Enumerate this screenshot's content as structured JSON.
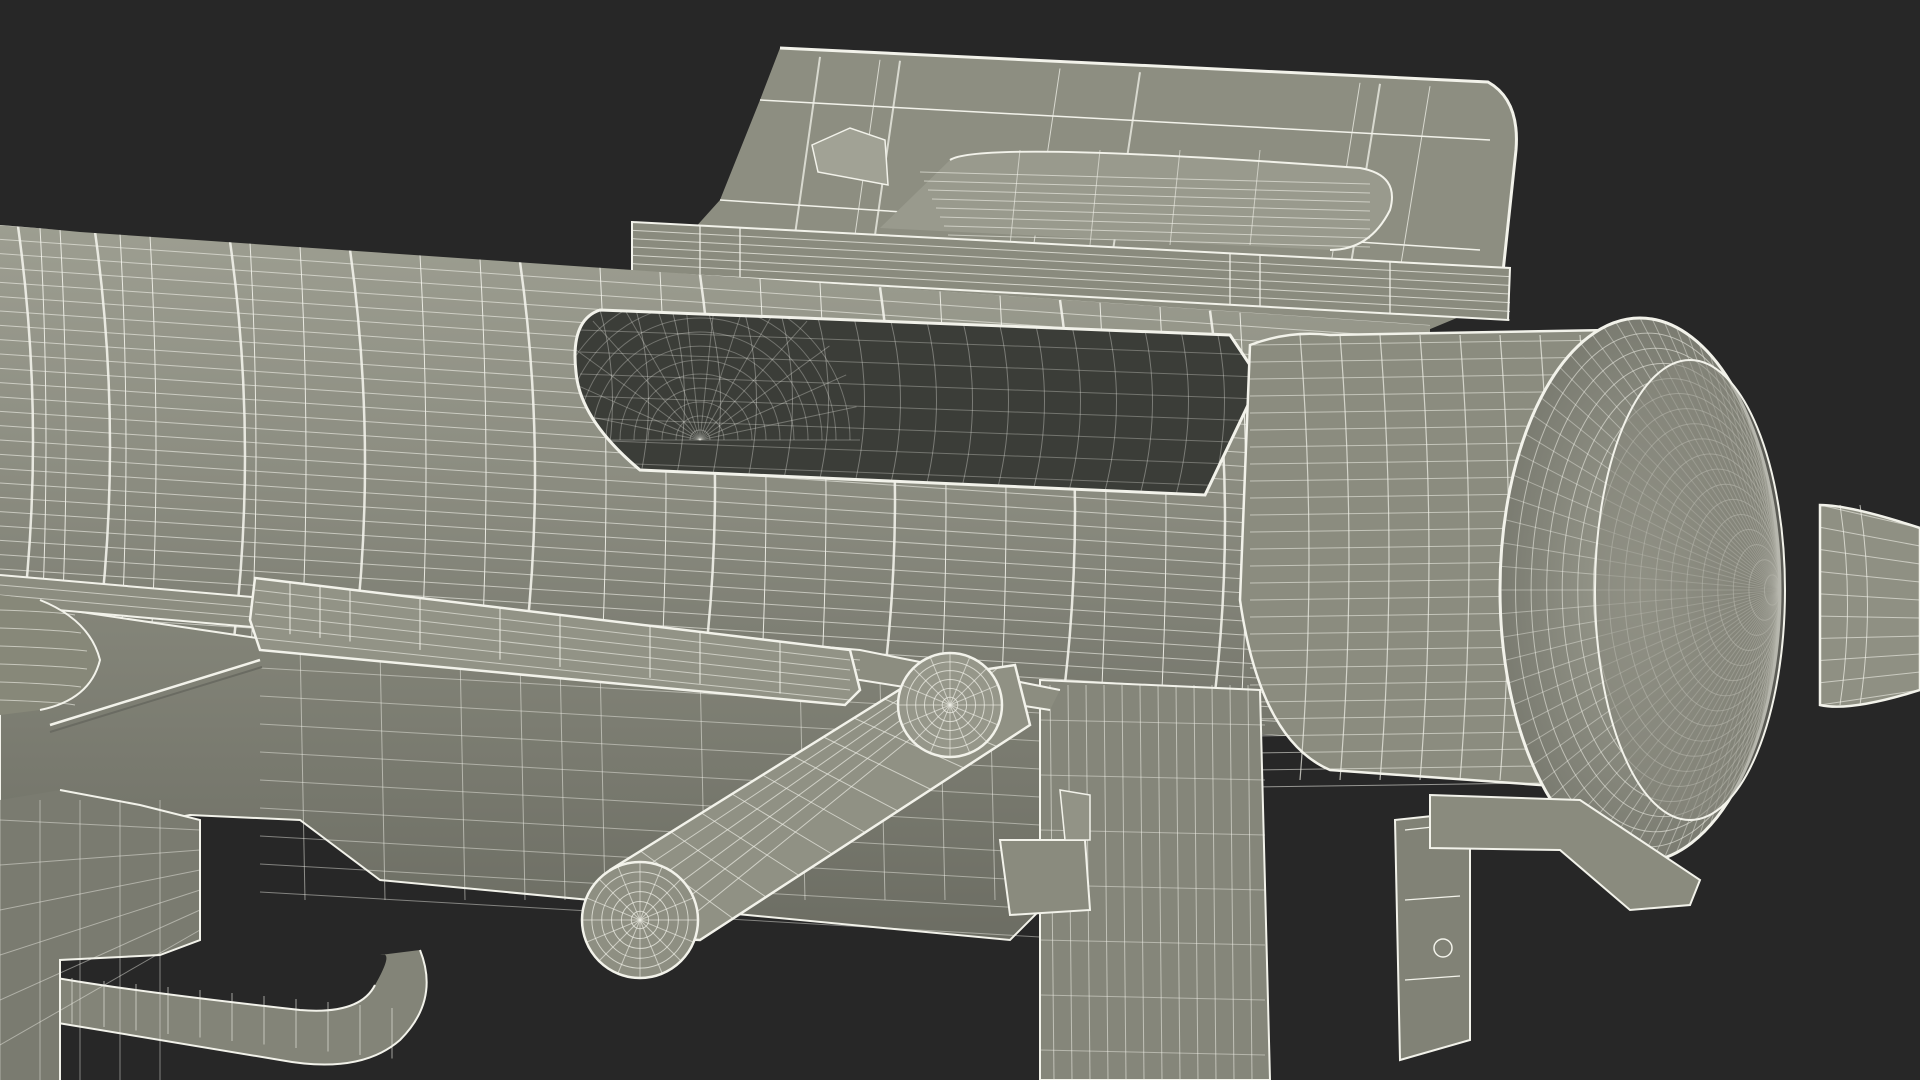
{
  "scene": {
    "background_color": "#272727",
    "mesh_fill_color": "#8e8f82",
    "mesh_fill_dark": "#6f7066",
    "mesh_fill_light": "#a2a396",
    "interior_color": "#3a3c37",
    "wire_color": "#f2f2ea",
    "render_style": "wireframe-over-shaded"
  }
}
